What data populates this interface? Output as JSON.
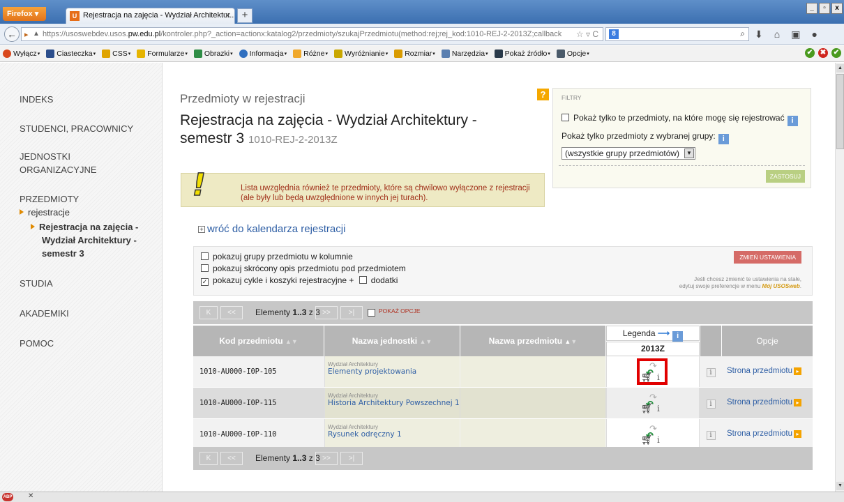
{
  "browser": {
    "firefox_label": "Firefox",
    "tab_title": "Rejestracja na zajęcia - Wydział Architektur...",
    "new_tab": "+",
    "url_prefix": "https://usoswebdev.usos.",
    "url_domain": "pw.edu.pl",
    "url_rest": "/kontroler.php?_action=actionx:katalog2/przedmioty/szukajPrzedmiotu(method:rej;rej_kod:1010-REJ-2-2013Z;callback",
    "search_engine_icon": "google-icon",
    "window_controls": [
      "_",
      "▫",
      "x"
    ]
  },
  "webdev_toolbar": {
    "items": [
      "Wyłącz",
      "Ciasteczka",
      "CSS",
      "Formularze",
      "Obrazki",
      "Informacja",
      "Różne",
      "Wyróżnianie",
      "Rozmiar",
      "Narzędzia",
      "Pokaż źródło",
      "Opcje"
    ],
    "item_colors": [
      "#d9481c",
      "#2b4e8c",
      "#e0a400",
      "#e6b400",
      "#2f8d46",
      "#2f6fbf",
      "#f0a82a",
      "#c9a700",
      "#d99b00",
      "#5a7fb0",
      "#2a3a4a",
      "#4a5a6a"
    ]
  },
  "sidebar": {
    "items": [
      "INDEKS",
      "STUDENCI, PRACOWNICY",
      "JEDNOSTKI",
      "ORGANIZACYJNE",
      "PRZEDMIOTY",
      "rejestracje",
      "Rejestracja na zajęcia -",
      "Wydział Architektury -",
      "semestr 3",
      "STUDIA",
      "AKADEMIKI",
      "POMOC"
    ]
  },
  "page": {
    "subtitle": "Przedmioty w rejestracji",
    "title_line1": "Rejestracja na zajęcia - Wydział Architektury -",
    "title_line2": "semestr 3",
    "title_code": "1010-REJ-2-2013Z",
    "help": "?"
  },
  "filters": {
    "heading": "FILTRY",
    "only_registrable": "Pokaż tylko te przedmioty, na które mogę się rejestrować",
    "only_group": "Pokaż tylko przedmioty z wybranej grupy:",
    "group_select": "(wszystkie grupy przedmiotów)",
    "apply": "ZASTOSUJ"
  },
  "warning": {
    "text": "Lista uwzględnia również te przedmioty, które są chwilowo wyłączone z rejestracji (ale były lub będą uwzględnione w innych jej turach)."
  },
  "back_link": "wróć do kalendarza rejestracji",
  "options": {
    "show_groups": "pokazuj grupy przedmiotu w kolumnie",
    "show_short_desc": "pokazuj skrócony opis przedmiotu pod przedmiotem",
    "show_cycles": "pokazuj cykle i koszyki rejestracyjne +",
    "extras": "dodatki",
    "change_settings": "ZMIEŃ USTAWIENIA",
    "note1": "Jeśli chcesz zmienić te ustawienia na stałe,",
    "note2": "edytuj swoje preferencje w menu",
    "note_link": "Mój USOSweb",
    "show_groups_checked": false,
    "show_short_desc_checked": false,
    "show_cycles_checked": true,
    "extras_checked": false
  },
  "pager": {
    "first": "K",
    "prev": "<<",
    "label_pre": "Elementy",
    "range": "1..3",
    "label_post": "z 3",
    "next": ">>",
    "last": ">|",
    "show_options": "POKAŻ OPCJE"
  },
  "table": {
    "col_code": "Kod przedmiotu",
    "col_unit": "Nazwa jednostki",
    "col_name": "Nazwa przedmiotu",
    "legend": "Legenda",
    "term": "2013Z",
    "col_options": "Opcje",
    "rows": [
      {
        "code": "1010-AU000-I0P-105",
        "unit": "Wydział Architektury",
        "name": "Elementy projektowania",
        "link": "Strona przedmiotu"
      },
      {
        "code": "1010-AU000-I0P-115",
        "unit": "Wydział Architektury",
        "name": "Historia Architektury Powszechnej 1",
        "link": "Strona przedmiotu"
      },
      {
        "code": "1010-AU000-I0P-110",
        "unit": "Wydział Architektury",
        "name": "Rysunek odręczny 1",
        "link": "Strona przedmiotu"
      }
    ]
  },
  "colors": {
    "link": "#2f5fa5",
    "header_gray": "#b6b6b6",
    "highlight_red": "#e10000",
    "warning_bg": "#eeeac4"
  }
}
